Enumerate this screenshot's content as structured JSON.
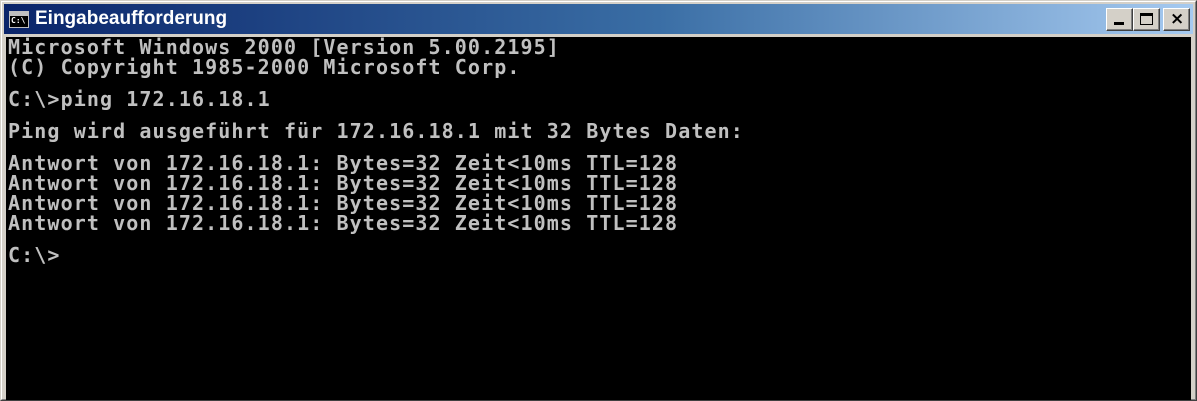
{
  "window": {
    "title": "Eingabeaufforderung",
    "icon": "console-app-icon",
    "icon_text": "C:\\",
    "buttons": {
      "minimize": "minimize-icon",
      "maximize": "maximize-icon",
      "close": "close-icon"
    },
    "colors": {
      "titlebar_start": "#0a246a",
      "titlebar_end": "#a6caf0",
      "console_bg": "#000000",
      "console_fg": "#c0c0c0",
      "chrome": "#d4d0c8"
    }
  },
  "console": {
    "header": [
      "Microsoft Windows 2000 [Version 5.00.2195]",
      "(C) Copyright 1985-2000 Microsoft Corp."
    ],
    "command": "C:\\>ping 172.16.18.1",
    "ping_intro": "Ping wird ausgeführt für 172.16.18.1 mit 32 Bytes Daten:",
    "replies": [
      "Antwort von 172.16.18.1: Bytes=32 Zeit<10ms TTL=128",
      "Antwort von 172.16.18.1: Bytes=32 Zeit<10ms TTL=128",
      "Antwort von 172.16.18.1: Bytes=32 Zeit<10ms TTL=128",
      "Antwort von 172.16.18.1: Bytes=32 Zeit<10ms TTL=128"
    ],
    "prompt": "C:\\>"
  }
}
